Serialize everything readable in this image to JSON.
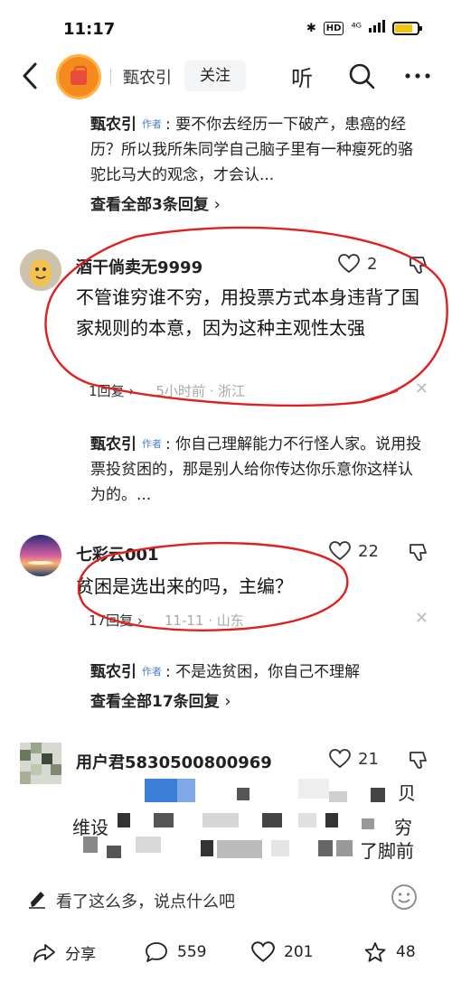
{
  "status_bar": {
    "time": "11:17",
    "hd": "HD",
    "signal": "⁴ᴳ",
    "battery_percent": 80
  },
  "nav": {
    "name": "甄农引",
    "follow": "关注",
    "listen": "听"
  },
  "thread1": {
    "replies": [
      {
        "author": "甄农引",
        "tag": "作者",
        "text": ": 要不你去经历一下破产，患癌的经历？所以我所朱同学自己脑子里有一种瘦死的骆驼比马大的观念，才会认..."
      }
    ],
    "view_all": "查看全部3条回复"
  },
  "comments": [
    {
      "user": "酒干倘卖无9999",
      "likes": "2",
      "text": "不管谁穷谁不穷，用投票方式本身违背了国家规则的本意，因为这种主观性太强",
      "replies_count": "1回复",
      "time_location": "5小时前 · 浙江",
      "reply": {
        "author": "甄农引",
        "tag": "作者",
        "text": ": 你自己理解能力不行怪人家。说用投票投贫困的，那是别人给你传达你乐意你这样认为的。..."
      }
    },
    {
      "user": "七彩云001",
      "likes": "22",
      "text": "贫困是选出来的吗，主编？",
      "replies_count": "17回复",
      "time_location": "11-11 · 山东",
      "reply": {
        "author": "甄农引",
        "tag": "作者",
        "text": ": 不是选贫困，你自己不理解"
      },
      "view_all": "查看全部17条回复"
    },
    {
      "user": "用户君5830500800969",
      "likes": "21",
      "text_fragments": [
        "维设",
        "贝",
        "穷",
        "了脚前"
      ]
    }
  ],
  "input": {
    "placeholder": "看了这么多，说点什么吧"
  },
  "actions": {
    "share": "分享",
    "comments": "559",
    "likes": "201",
    "favorites": "48"
  },
  "colors": {
    "accent_blue": "#4a7fd6",
    "annotation_red": "#e02020",
    "logo_orange": "#f58a1f"
  }
}
